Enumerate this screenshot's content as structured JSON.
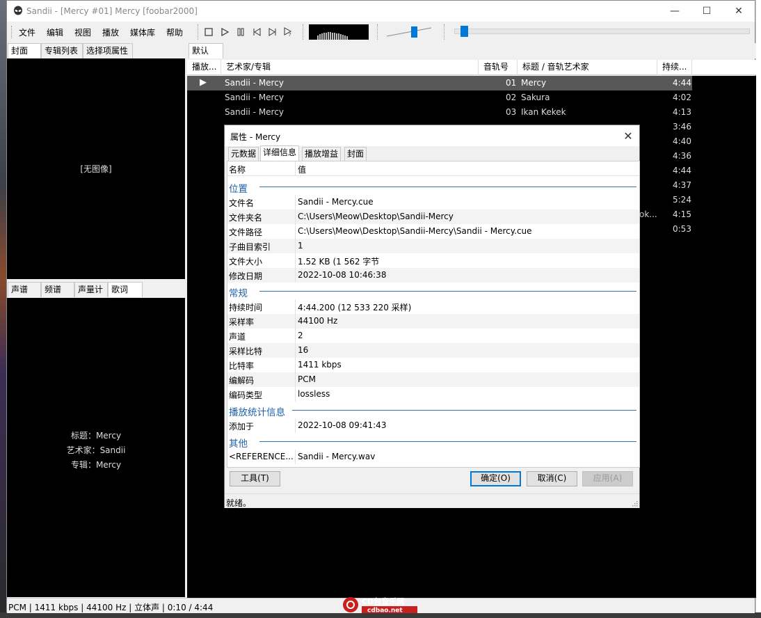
{
  "window": {
    "title": "Sandii - [Mercy #01] Mercy  [foobar2000]",
    "minimize_glyph": "—",
    "maximize_glyph": "☐",
    "close_glyph": "✕"
  },
  "menu": [
    "文件",
    "编辑",
    "视图",
    "播放",
    "媒体库",
    "帮助"
  ],
  "left_tabs_top": [
    "封面",
    "专辑列表",
    "选择项属性"
  ],
  "left_tabs_bottom": [
    "声谱",
    "频谱",
    "声量计",
    "歌词"
  ],
  "cover_panel": {
    "no_image": "[无图像]"
  },
  "lyrics_panel": {
    "lines": [
      "标题：Mercy",
      "艺术家：Sandii",
      "专辑：Mercy"
    ]
  },
  "playlist": {
    "tab": "默认",
    "columns": [
      "播放...",
      "艺术家/专辑",
      "音轨号",
      "标题 / 音轨艺术家",
      "持续..."
    ],
    "playing_glyph": "▶",
    "rows": [
      {
        "artist": "Sandii - Mercy",
        "num": "01",
        "title": "Mercy",
        "dur": "4:44"
      },
      {
        "artist": "Sandii - Mercy",
        "num": "02",
        "title": "Sakura",
        "dur": "4:02"
      },
      {
        "artist": "Sandii - Mercy",
        "num": "03",
        "title": "Ikan Kekek",
        "dur": "4:13"
      },
      {
        "artist": "",
        "num": "",
        "title": "",
        "dur": "3:46"
      },
      {
        "artist": "",
        "num": "",
        "title": "",
        "dur": "4:40"
      },
      {
        "artist": "",
        "num": "",
        "title": "",
        "dur": "4:36"
      },
      {
        "artist": "",
        "num": "",
        "title": "",
        "dur": "4:44"
      },
      {
        "artist": "",
        "num": "",
        "title": "",
        "dur": "4:37"
      },
      {
        "artist": "",
        "num": "",
        "title": "",
        "dur": "5:24"
      },
      {
        "artist": "",
        "num": "",
        "title": "ok...",
        "dur": "4:15"
      },
      {
        "artist": "",
        "num": "",
        "title": "",
        "dur": "0:53"
      }
    ]
  },
  "status": "PCM | 1411 kbps | 44100 Hz | 立体声 | 0:10 / 4:44",
  "watermark": {
    "line1": "CD包音乐网",
    "line2": "cdbao.net"
  },
  "dialog": {
    "title": "属性 - Mercy",
    "close_glyph": "✕",
    "tabs": [
      "元数据",
      "详细信息",
      "播放增益",
      "封面"
    ],
    "columns": [
      "名称",
      "值"
    ],
    "sections": [
      {
        "title": "位置",
        "rows": [
          {
            "k": "文件名",
            "v": "Sandii - Mercy.cue"
          },
          {
            "k": "文件夹名",
            "v": "C:\\Users\\Meow\\Desktop\\Sandii-Mercy"
          },
          {
            "k": "文件路径",
            "v": "C:\\Users\\Meow\\Desktop\\Sandii-Mercy\\Sandii - Mercy.cue"
          },
          {
            "k": "子曲目索引",
            "v": "1"
          },
          {
            "k": "文件大小",
            "v": "1.52 KB (1 562 字节"
          },
          {
            "k": "修改日期",
            "v": "2022-10-08 10:46:38"
          }
        ]
      },
      {
        "title": "常规",
        "rows": [
          {
            "k": "持续时间",
            "v": "4:44.200 (12 533 220 采样)"
          },
          {
            "k": "采样率",
            "v": "44100 Hz"
          },
          {
            "k": "声道",
            "v": "2"
          },
          {
            "k": "采样比特",
            "v": "16"
          },
          {
            "k": "比特率",
            "v": "1411 kbps"
          },
          {
            "k": "编解码",
            "v": "PCM"
          },
          {
            "k": "编码类型",
            "v": "lossless"
          }
        ]
      },
      {
        "title": "播放统计信息",
        "rows": [
          {
            "k": "添加于",
            "v": "2022-10-08 09:41:43"
          }
        ]
      },
      {
        "title": "其他",
        "rows": [
          {
            "k": "<REFERENCE...",
            "v": "Sandii - Mercy.wav"
          }
        ]
      }
    ],
    "buttons": {
      "tools": "工具(T)",
      "ok": "确定(O)",
      "cancel": "取消(C)",
      "apply": "应用(A)"
    },
    "status": "就绪。"
  },
  "colors": {
    "accent": "#0078d7",
    "section_title": "#1f5fa8",
    "playlist_bg": "#000000",
    "selected_row": "#585858"
  },
  "icons": {
    "app": "alien-icon",
    "toolbar": [
      "stop-icon",
      "play-icon",
      "pause-icon",
      "previous-icon",
      "next-icon",
      "random-icon"
    ]
  }
}
